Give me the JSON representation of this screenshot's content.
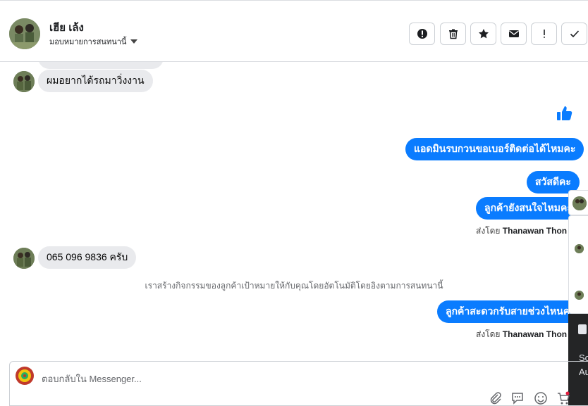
{
  "header": {
    "contact_name": "เฮีย เล้ง",
    "subtitle": "มอบหมายการสนทนานี้",
    "icons": [
      "alert-circle-icon",
      "trash-icon",
      "star-icon",
      "mail-icon",
      "exclamation-icon",
      "check-icon"
    ]
  },
  "messages": {
    "in_1": "ผมอยากได้รถมาวิ่งงาน",
    "out_1": "แอดมินรบกวนขอเบอร์ติดต่อได้ไหมคะ",
    "out_2": "สวัสดีคะ",
    "out_3": "ลูกค้ายังสนใจไหมคะ",
    "in_2": "065 096 9836 ครับ",
    "out_4": "ลูกค้าสะดวกรับสายช่วงไหนคะ"
  },
  "sent_by": {
    "prefix": "ส่งโดย",
    "name": "Thanawan Thon"
  },
  "system_note": "เราสร้างกิจกรรมของลูกค้าเป้าหมายให้กับคุณโดยอัตโนมัติโดยอิงตามการสนทนานี้",
  "side_panel": {
    "line1": "So",
    "line2": "Au"
  },
  "composer": {
    "placeholder": "ตอบกลับใน Messenger..."
  },
  "colors": {
    "outgoing_bubble": "#0a7cff",
    "incoming_bubble": "#e9eaed"
  }
}
